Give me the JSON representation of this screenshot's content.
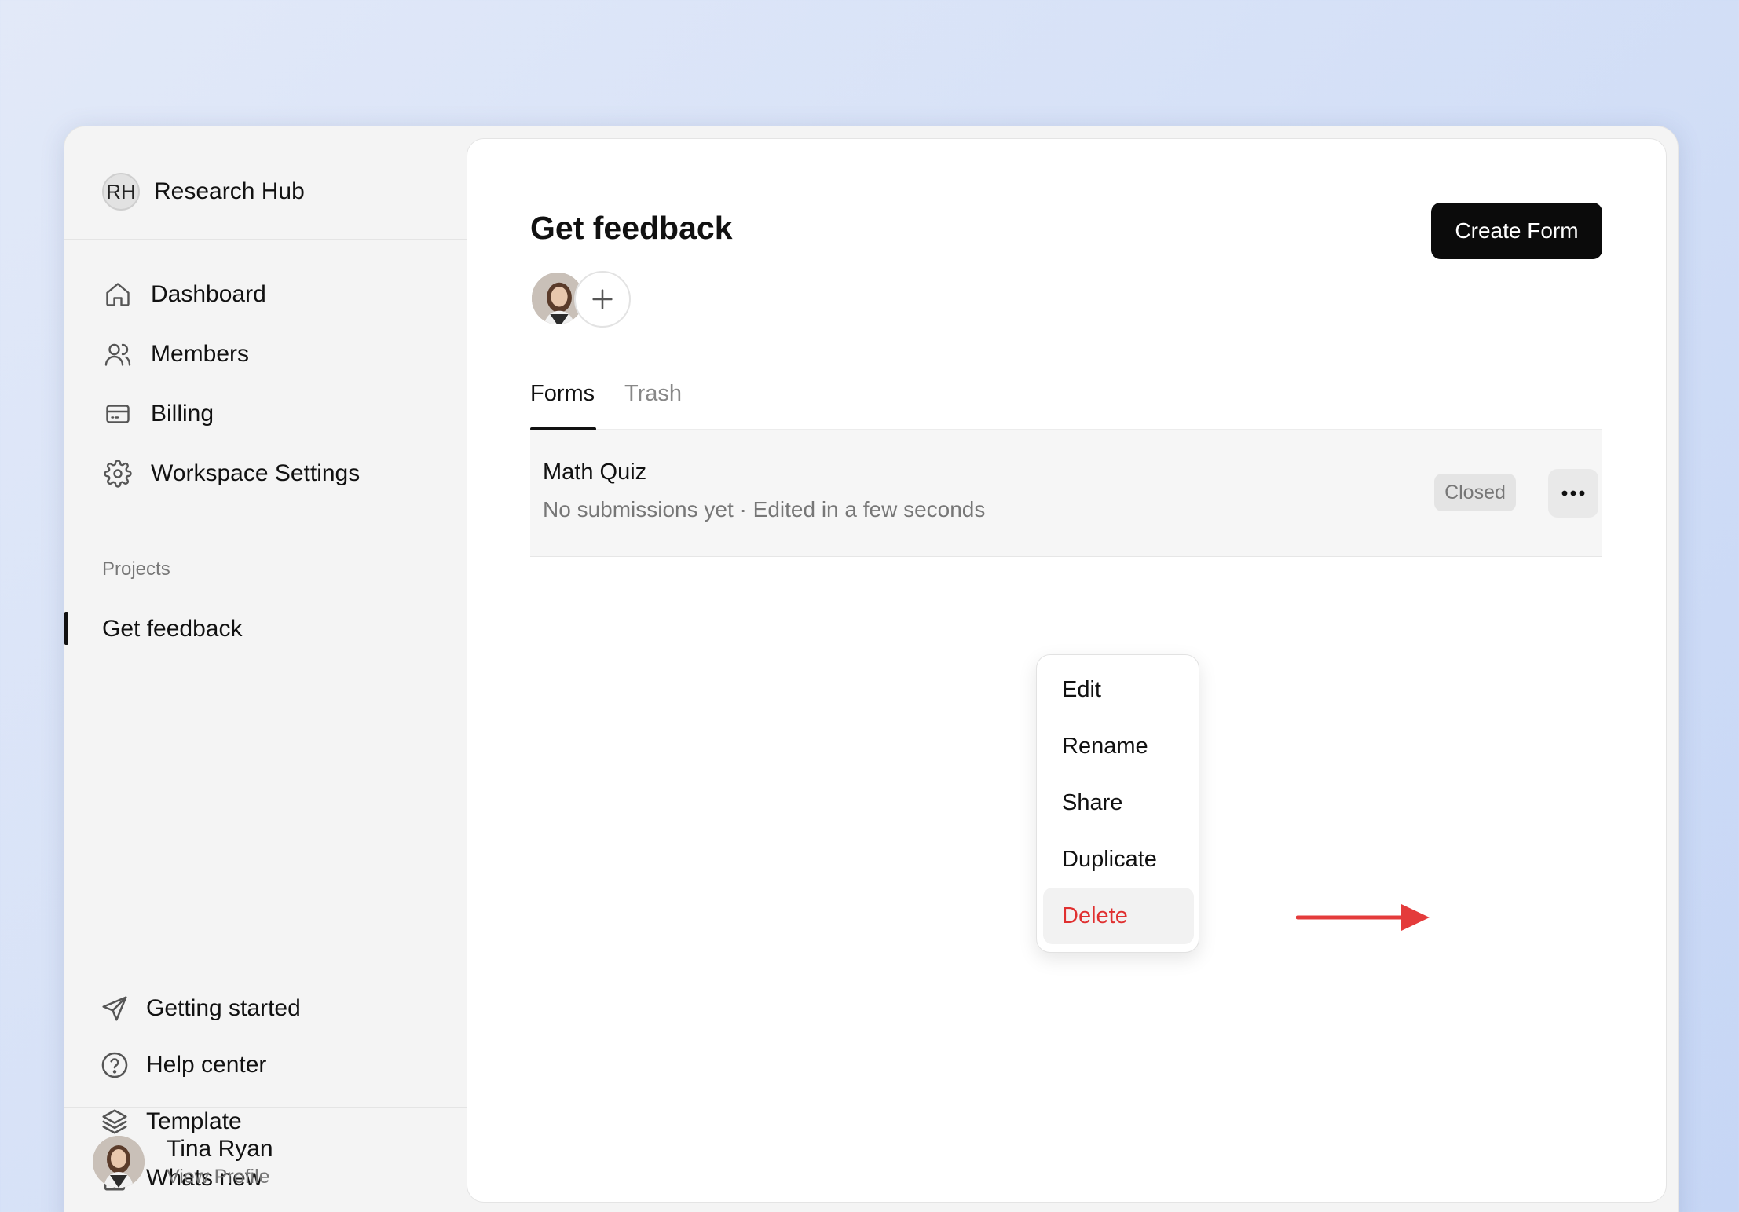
{
  "workspace": {
    "initials": "RH",
    "name": "Research Hub"
  },
  "nav": [
    {
      "label": "Dashboard",
      "icon": "home-icon"
    },
    {
      "label": "Members",
      "icon": "users-icon"
    },
    {
      "label": "Billing",
      "icon": "credit-card-icon"
    },
    {
      "label": "Workspace Settings",
      "icon": "gear-icon"
    }
  ],
  "projects": {
    "section_label": "Projects",
    "items": [
      {
        "label": "Get feedback",
        "active": true
      }
    ]
  },
  "bottom_nav": [
    {
      "label": "Getting started",
      "icon": "send-icon"
    },
    {
      "label": "Help center",
      "icon": "help-circle-icon"
    },
    {
      "label": "Template",
      "icon": "layers-icon"
    },
    {
      "label": "Whats new",
      "icon": "gift-icon"
    }
  ],
  "profile": {
    "name": "Tina Ryan",
    "subtitle": "View Profile"
  },
  "main": {
    "title": "Get feedback",
    "create_label": "Create Form",
    "tabs": [
      {
        "label": "Forms",
        "active": true
      },
      {
        "label": "Trash",
        "active": false
      }
    ],
    "forms": [
      {
        "title": "Math Quiz",
        "meta": "No submissions yet · Edited in a few seconds",
        "status": "Closed"
      }
    ]
  },
  "context_menu": {
    "items": [
      {
        "label": "Edit"
      },
      {
        "label": "Rename"
      },
      {
        "label": "Share"
      },
      {
        "label": "Duplicate"
      },
      {
        "label": "Delete",
        "danger": true,
        "highlighted": true
      }
    ]
  },
  "colors": {
    "accent": "#0b0b0b",
    "danger": "#e03030",
    "annotation_arrow": "#e43b3b"
  }
}
